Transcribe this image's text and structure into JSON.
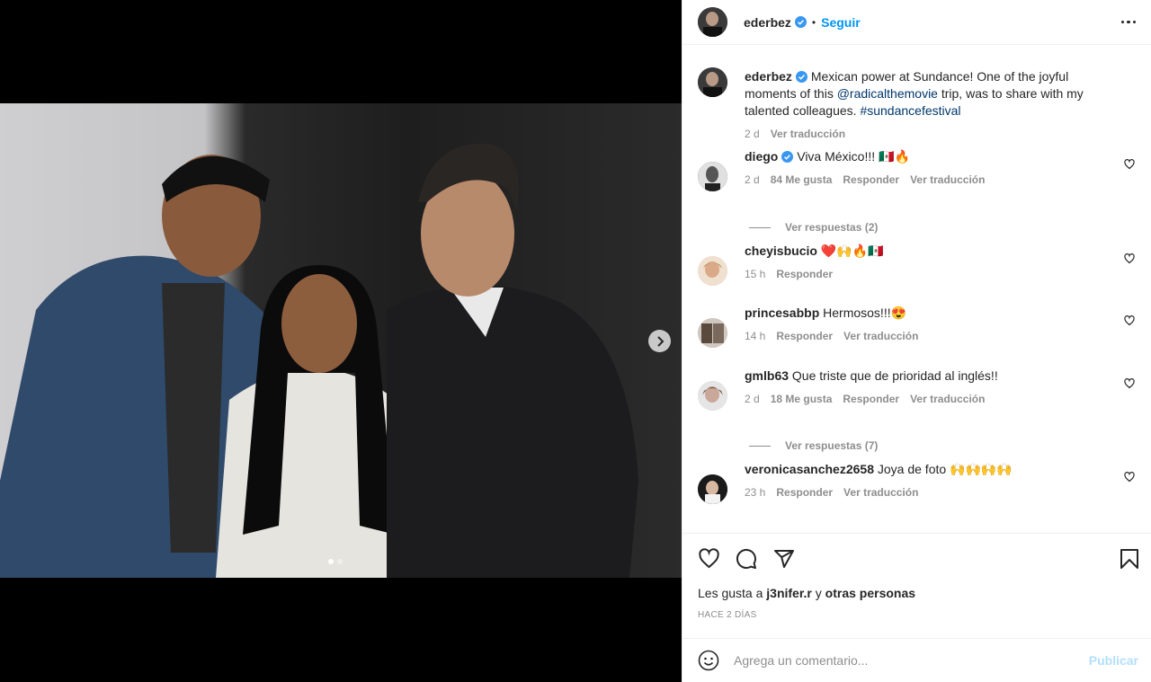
{
  "post": {
    "username": "ederbez",
    "follow_label": "Seguir",
    "separator": "•"
  },
  "caption": {
    "username": "ederbez",
    "text_before": "Mexican power at Sundance! One of the joyful moments of this ",
    "mention": "@radicalthemovie",
    "text_middle": " trip, was to share with my talented colleagues. ",
    "hashtag": "#sundancefestival",
    "time": "2 d",
    "translate": "Ver traducción"
  },
  "comments": [
    {
      "username": "diego",
      "verified": true,
      "text": "Viva México!!! 🇲🇽🔥",
      "time": "2 d",
      "likes": "84 Me gusta",
      "reply": "Responder",
      "translate": "Ver traducción",
      "view_replies": "Ver respuestas (2)"
    },
    {
      "username": "cheyisbucio",
      "verified": false,
      "text": "❤️🙌🔥🇲🇽",
      "time": "15 h",
      "likes": "",
      "reply": "Responder",
      "translate": ""
    },
    {
      "username": "princesabbp",
      "verified": false,
      "text": "Hermosos!!!😍",
      "time": "14 h",
      "likes": "",
      "reply": "Responder",
      "translate": "Ver traducción"
    },
    {
      "username": "gmlb63",
      "verified": false,
      "text": "Que triste que de prioridad al inglés!!",
      "time": "2 d",
      "likes": "18 Me gusta",
      "reply": "Responder",
      "translate": "Ver traducción",
      "view_replies": "Ver respuestas (7)"
    },
    {
      "username": "veronicasanchez2658",
      "verified": false,
      "text": "Joya de foto 🙌🙌🙌🙌",
      "time": "23 h",
      "likes": "",
      "reply": "Responder",
      "translate": "Ver traducción"
    }
  ],
  "likes_line": {
    "prefix": "Les gusta a ",
    "user": "j3nifer.r",
    "middle": " y ",
    "others": "otras personas"
  },
  "post_date": "HACE 2 DÍAS",
  "add_comment": {
    "placeholder": "Agrega un comentario...",
    "publish_label": "Publicar"
  },
  "colors": {
    "accent": "#0095f6",
    "verified": "#3897f0",
    "link": "#00376b",
    "muted": "#8e8e8e"
  },
  "icons": [
    "heart-icon",
    "comment-icon",
    "share-icon",
    "bookmark-icon",
    "emoji-icon",
    "chevron-right-icon",
    "more-icon",
    "verified-icon"
  ]
}
